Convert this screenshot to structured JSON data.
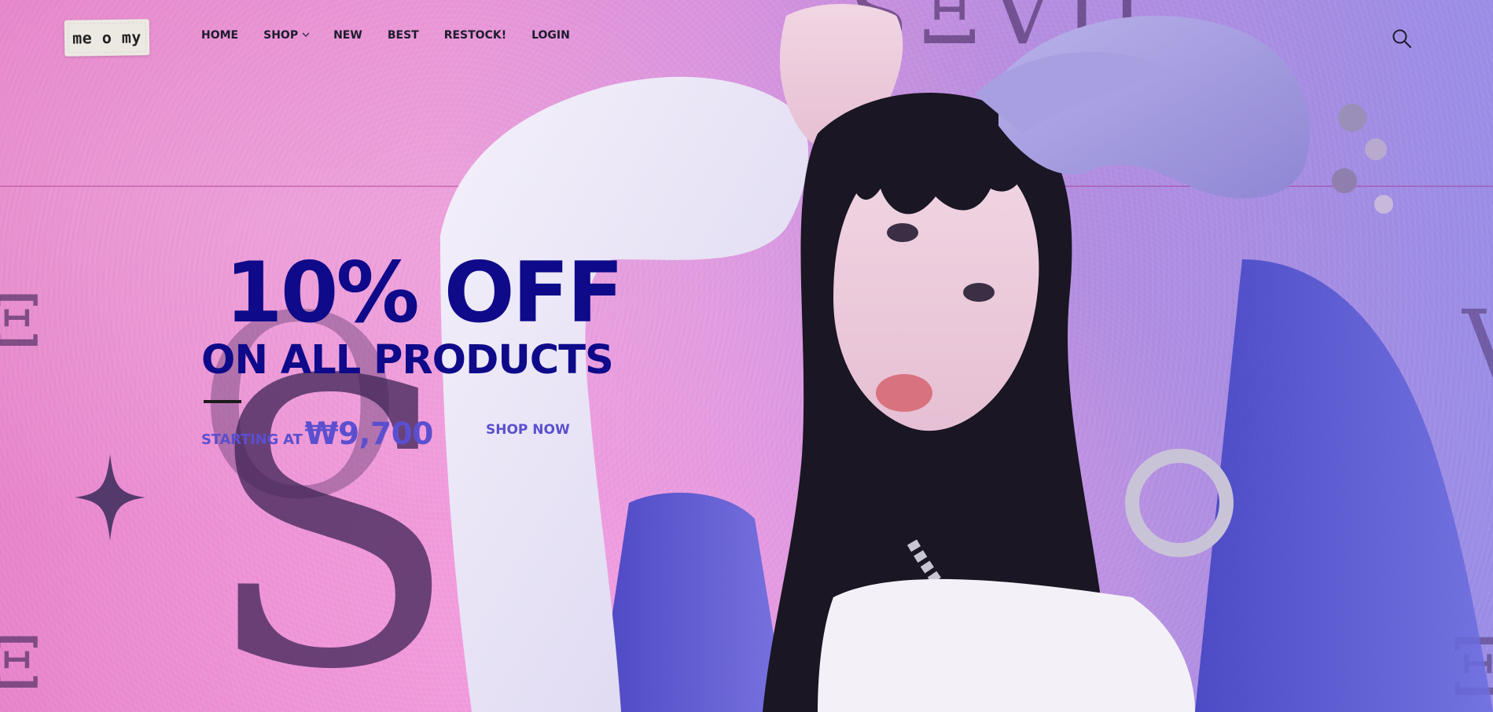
{
  "brand": {
    "logo_text": "me o my"
  },
  "nav": {
    "items": [
      {
        "label": "HOME",
        "has_dropdown": false
      },
      {
        "label": "SHOP",
        "has_dropdown": true
      },
      {
        "label": "NEW",
        "has_dropdown": false
      },
      {
        "label": "BEST",
        "has_dropdown": false
      },
      {
        "label": "RESTOCK!",
        "has_dropdown": false
      },
      {
        "label": "LOGIN",
        "has_dropdown": false
      }
    ],
    "search_icon": "search-icon"
  },
  "hero": {
    "headline": "10% OFF",
    "subheadline": "ON ALL PRODUCTS",
    "price_label": "STARTING AT",
    "price_value": "₩9,700",
    "cta_label": "SHOP NOW"
  },
  "colors": {
    "headline": "#0e0a8a",
    "price": "#5b4fcf",
    "nav_text": "#1c1c2e",
    "hero_background": "#e98fd0"
  }
}
